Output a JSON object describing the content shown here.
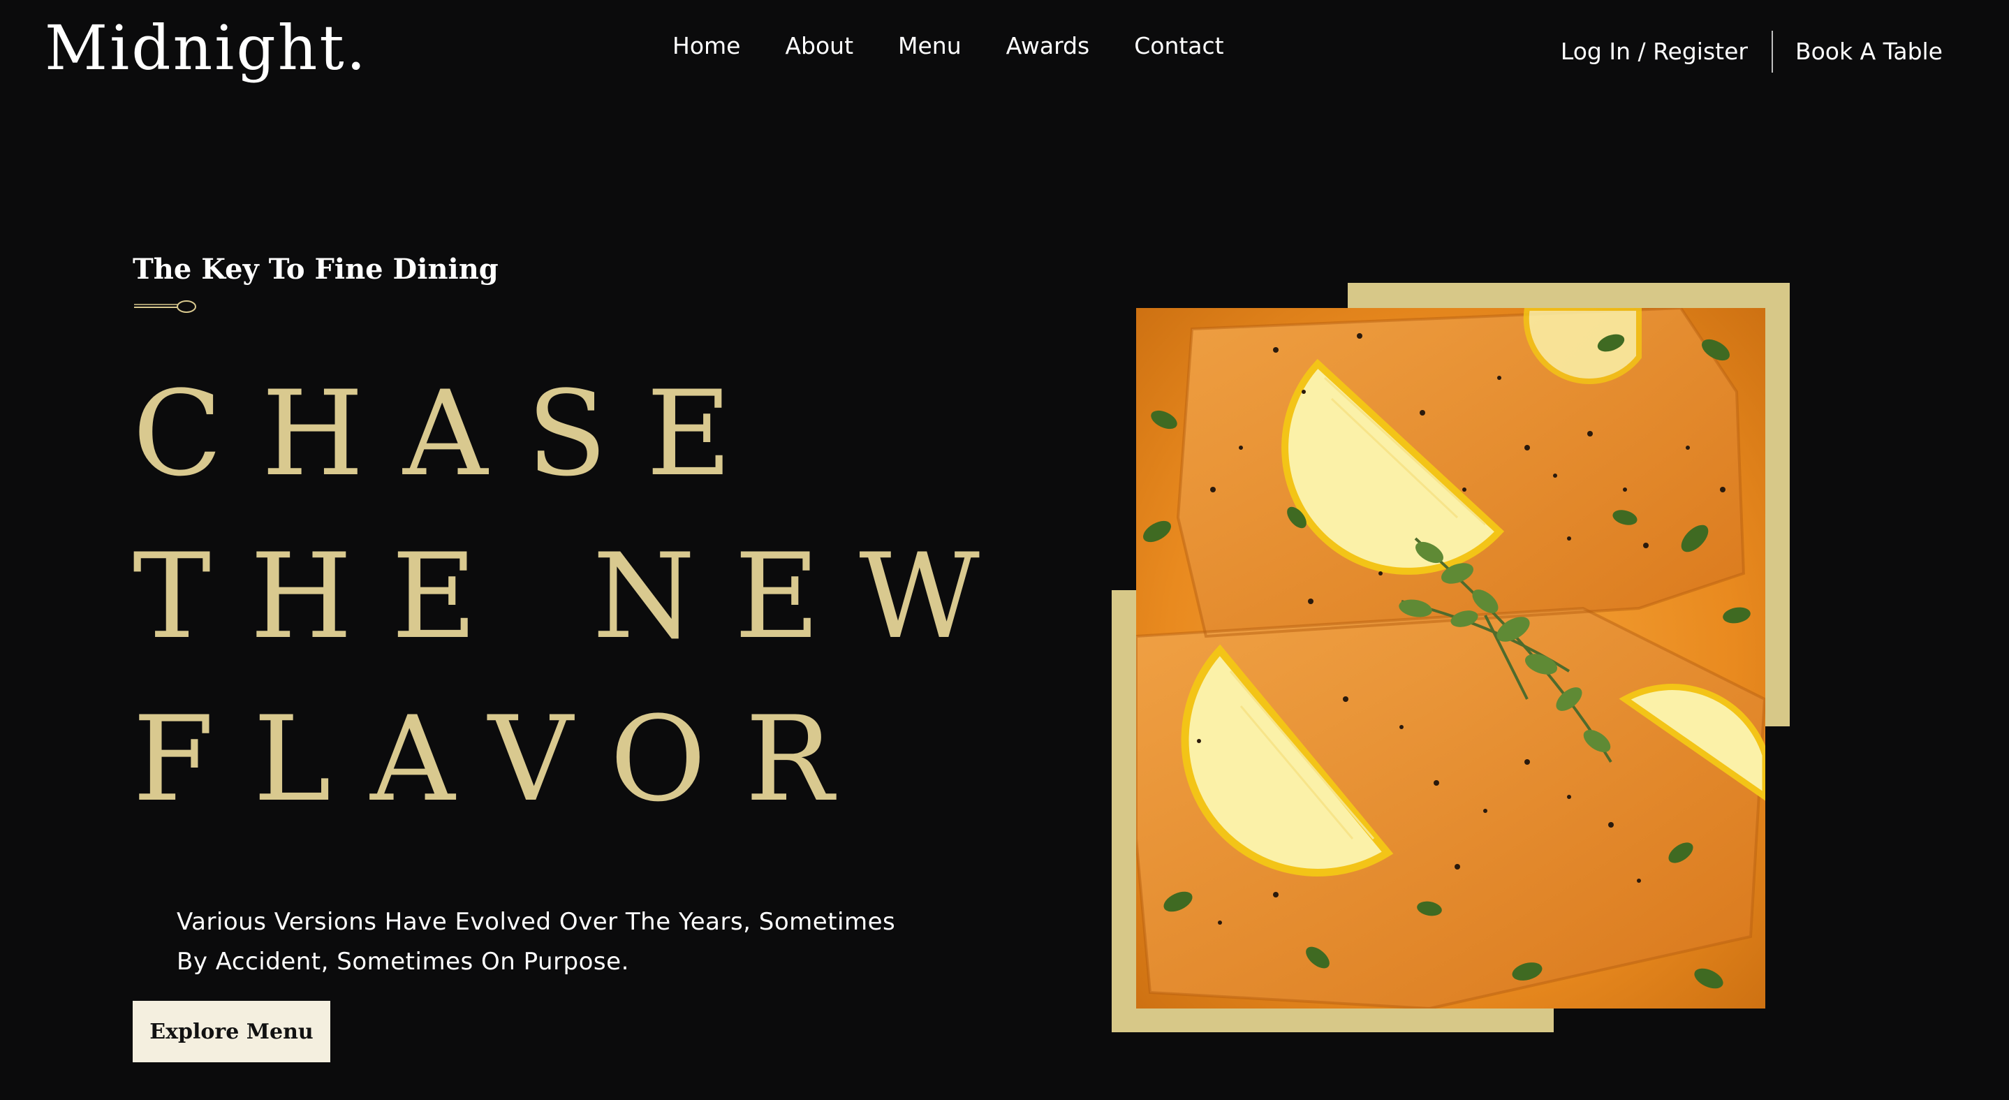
{
  "header": {
    "logo": "Midnight.",
    "nav": [
      {
        "label": "Home"
      },
      {
        "label": "About"
      },
      {
        "label": "Menu"
      },
      {
        "label": "Awards"
      },
      {
        "label": "Contact"
      }
    ],
    "login_label": "Log In / Register",
    "book_label": "Book A Table"
  },
  "hero": {
    "eyebrow": "The Key To Fine Dining",
    "headline": [
      "CHASE",
      "THE NEW",
      "FLAVOR"
    ],
    "description": "Various Versions Have Evolved Over The Years, Sometimes By Accident, Sometimes On Purpose.",
    "cta_label": "Explore Menu",
    "image_icon": "salmon-dish-photo",
    "divider_icon": "spoon-icon"
  },
  "colors": {
    "background": "#0b0b0c",
    "accent_gold": "#d9c98f",
    "frame_gold": "#d7c888",
    "button_bg": "#f4efdf"
  }
}
